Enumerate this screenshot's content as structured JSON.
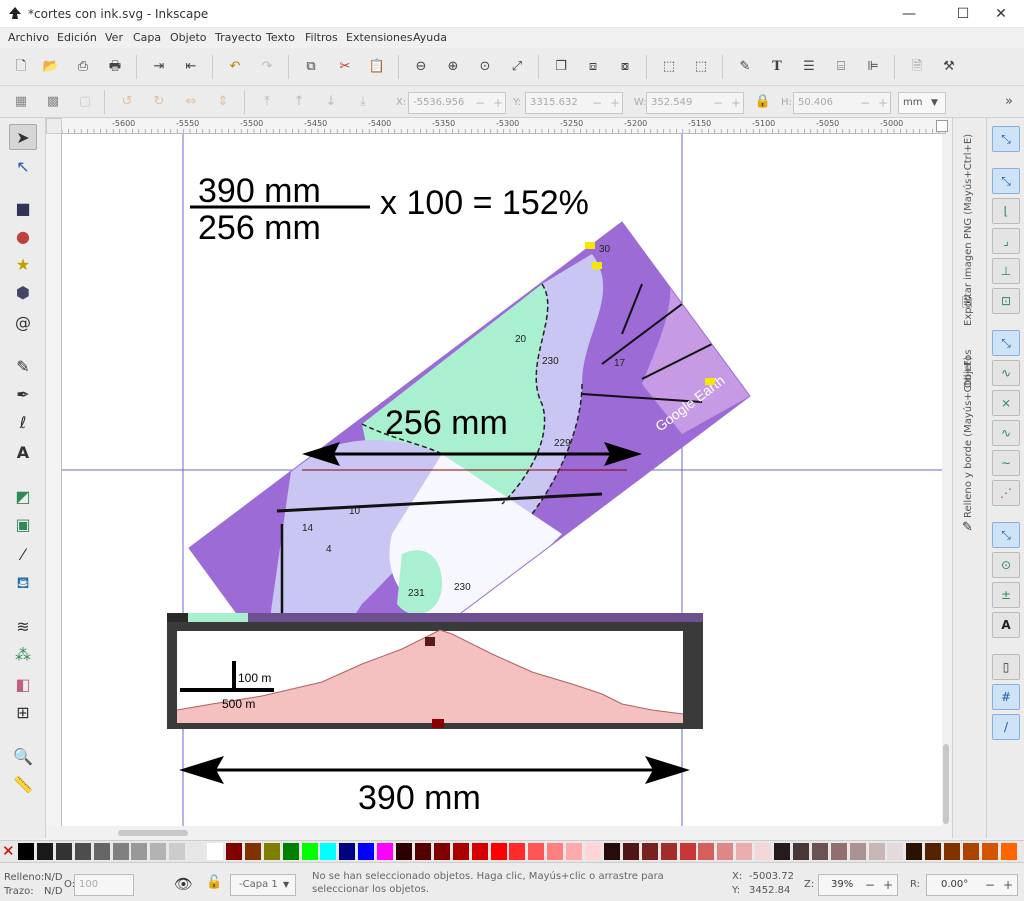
{
  "window": {
    "title": "*cortes con ink.svg - Inkscape",
    "min": "—",
    "max": "☐",
    "close": "✕"
  },
  "menu": [
    "Archivo",
    "Edición",
    "Ver",
    "Capa",
    "Objeto",
    "Trayecto",
    "Texto",
    "Filtros",
    "Extensiones",
    "Ayuda"
  ],
  "controls": {
    "x_label": "X:",
    "x_value": "-5536.956",
    "y_label": "Y:",
    "y_value": "3315.632",
    "w_label": "W:",
    "w_value": "352.549",
    "h_label": "H:",
    "h_value": "50.406",
    "unit": "mm"
  },
  "ruler_h": [
    "-5600",
    "-5550",
    "-5500",
    "-5450",
    "-5400",
    "-5350",
    "-5300",
    "-5250",
    "-5200",
    "-5150",
    "-5100",
    "-5050",
    "-5000"
  ],
  "canvas": {
    "formula_top": "390 mm",
    "formula_bottom": "256 mm",
    "formula_rest": "x 100 = 152%",
    "map_label": "256 mm",
    "bottom_label": "390 mm",
    "scale_vertical": "100 m",
    "scale_horizontal": "500 m",
    "google_earth": "Google Earth",
    "contours": [
      "20",
      "230",
      "17",
      "30",
      "229",
      "14",
      "10",
      "4",
      "231",
      "230"
    ]
  },
  "dock": {
    "tabs": [
      "Exportar imagen PNG (Mayús+Ctrl+E)",
      "Objetos",
      "Relleno y borde (Mayús+Ctrl+F)"
    ]
  },
  "palette": [
    "#000000",
    "#1a1a1a",
    "#333333",
    "#4d4d4d",
    "#666666",
    "#808080",
    "#999999",
    "#b3b3b3",
    "#cccccc",
    "#e6e6e6",
    "#ffffff",
    "#800000",
    "#803300",
    "#808000",
    "#008000",
    "#00ff00",
    "#00ffff",
    "#000080",
    "#0000ff",
    "#ff00ff",
    "#2b0000",
    "#550000",
    "#800000",
    "#aa0000",
    "#d40000",
    "#ff0000",
    "#ff2a2a",
    "#ff5555",
    "#ff8080",
    "#ffaaaa",
    "#ffd5d5",
    "#280b0b",
    "#501616",
    "#782121",
    "#a02c2c",
    "#c83737",
    "#d35f5f",
    "#de8787",
    "#e9afaf",
    "#f4d7d7",
    "#241c1c",
    "#483737",
    "#6c5353",
    "#916f6f",
    "#ac9393",
    "#c8b7b7",
    "#e3dbdb",
    "#2b1100",
    "#552200",
    "#803300",
    "#aa4400",
    "#d45500",
    "#ff6600"
  ],
  "status": {
    "fill_label": "Relleno:",
    "fill_value": "N/D",
    "stroke_label": "Trazo:",
    "stroke_value": "N/D",
    "opacity_label": "O:",
    "opacity_value": "100",
    "layer": "-Capa 1",
    "message": "No se han seleccionado objetos. Haga clic, Mayús+clic o arrastre para seleccionar los objetos.",
    "cx_label": "X:",
    "cx_value": "-5003.72",
    "cy_label": "Y:",
    "cy_value": "3452.84",
    "z_label": "Z:",
    "zoom": "39%",
    "r_label": "R:",
    "rotation": "0.00°"
  }
}
